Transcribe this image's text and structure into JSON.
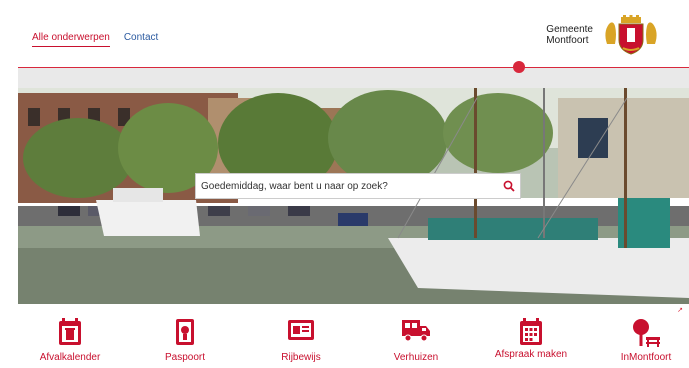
{
  "nav": {
    "items": [
      {
        "label": "Alle onderwerpen",
        "active": true
      },
      {
        "label": "Contact",
        "active": false
      }
    ]
  },
  "logo": {
    "line1": "Gemeente",
    "line2": "Montfoort"
  },
  "search": {
    "placeholder": "Goedemiddag, waar bent u naar op zoek?"
  },
  "colors": {
    "accent": "#c8102e",
    "link": "#2b5aa0"
  },
  "tiles": [
    {
      "label": "Afvalkalender",
      "icon": "calendar-trash-icon"
    },
    {
      "label": "Paspoort",
      "icon": "passport-icon"
    },
    {
      "label": "Rijbewijs",
      "icon": "id-card-icon"
    },
    {
      "label": "Verhuizen",
      "icon": "moving-truck-icon"
    },
    {
      "label": "Afspraak maken",
      "icon": "calendar-grid-icon"
    },
    {
      "label": "InMontfoort",
      "icon": "tree-bench-icon"
    }
  ]
}
